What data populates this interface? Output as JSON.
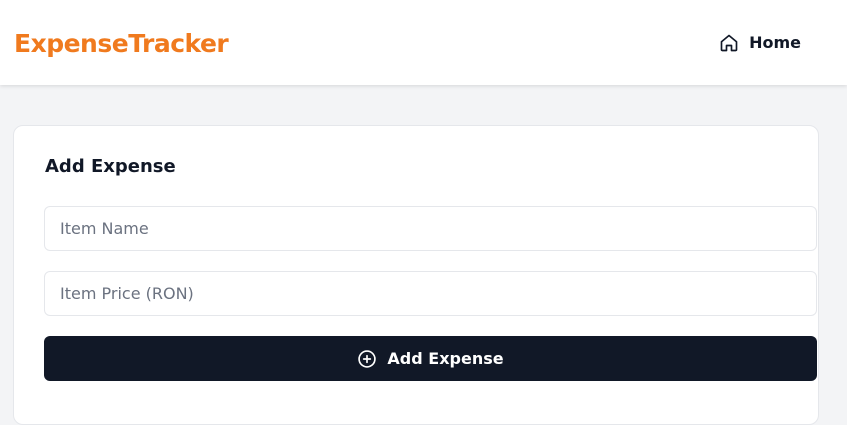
{
  "navbar": {
    "brand": "ExpenseTracker",
    "brand_color": "#f07a1e",
    "home_label": "Home",
    "home_icon": "home-icon"
  },
  "form": {
    "title": "Add Expense",
    "item_name": {
      "value": "",
      "placeholder": "Item Name"
    },
    "item_price": {
      "value": "",
      "placeholder": "Item Price (RON)"
    },
    "submit_label": "Add Expense",
    "submit_icon": "plus-circle-icon",
    "button_color": "#111827"
  }
}
